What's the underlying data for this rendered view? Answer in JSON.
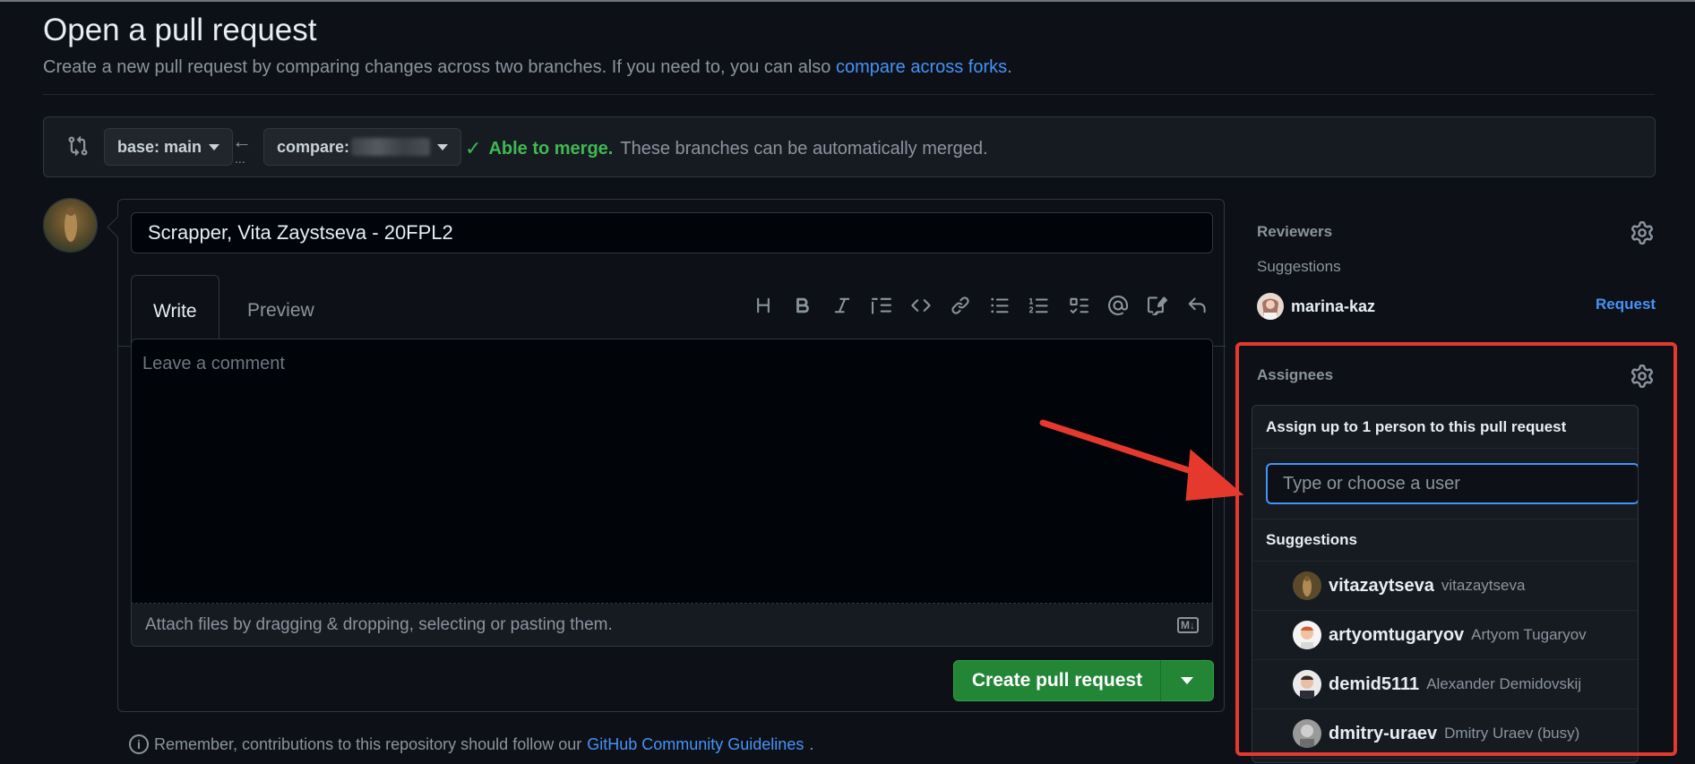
{
  "header": {
    "title": "Open a pull request",
    "subtitle_prefix": "Create a new pull request by comparing changes across two branches. If you need to, you can also ",
    "subtitle_link": "compare across forks",
    "subtitle_suffix": "."
  },
  "compare": {
    "base_label": "base: main",
    "compare_label": "compare:",
    "dots": "...",
    "merge_ok": "Able to merge.",
    "merge_msg": "These branches can be automatically merged."
  },
  "editor": {
    "title_value": "Scrapper, Vita Zaystseva - 20FPL2",
    "tabs": [
      "Write",
      "Preview"
    ],
    "toolbar_icons": [
      "heading-icon",
      "bold-icon",
      "italic-icon",
      "quote-icon",
      "code-icon",
      "link-icon",
      "unordered-list-icon",
      "ordered-list-icon",
      "task-list-icon",
      "mention-icon",
      "reference-icon",
      "reply-icon"
    ],
    "comment_placeholder": "Leave a comment",
    "attach_text": "Attach files by dragging & dropping, selecting or pasting them.",
    "markdown_badge": "M↓",
    "create_button": "Create pull request"
  },
  "footer": {
    "prefix": "Remember, contributions to this repository should follow our ",
    "link": "GitHub Community Guidelines",
    "suffix": "."
  },
  "sidebar": {
    "reviewers": {
      "label": "Reviewers",
      "suggestions_label": "Suggestions",
      "suggested_user": "marina-kaz",
      "request_label": "Request"
    },
    "assignees": {
      "label": "Assignees",
      "popover_header": "Assign up to 1 person to this pull request",
      "input_placeholder": "Type or choose a user",
      "suggestions_label": "Suggestions",
      "users": [
        {
          "login": "vitazaytseva",
          "full": "vitazaytseva"
        },
        {
          "login": "artyomtugaryov",
          "full": "Artyom Tugaryov"
        },
        {
          "login": "demid5111",
          "full": "Alexander Demidovskij"
        },
        {
          "login": "dmitry-uraev",
          "full": "Dmitry Uraev (busy)"
        }
      ]
    }
  },
  "colors": {
    "accent": "#4493f8",
    "success": "#3fb950",
    "button": "#238636",
    "annotation": "#e5392e"
  }
}
